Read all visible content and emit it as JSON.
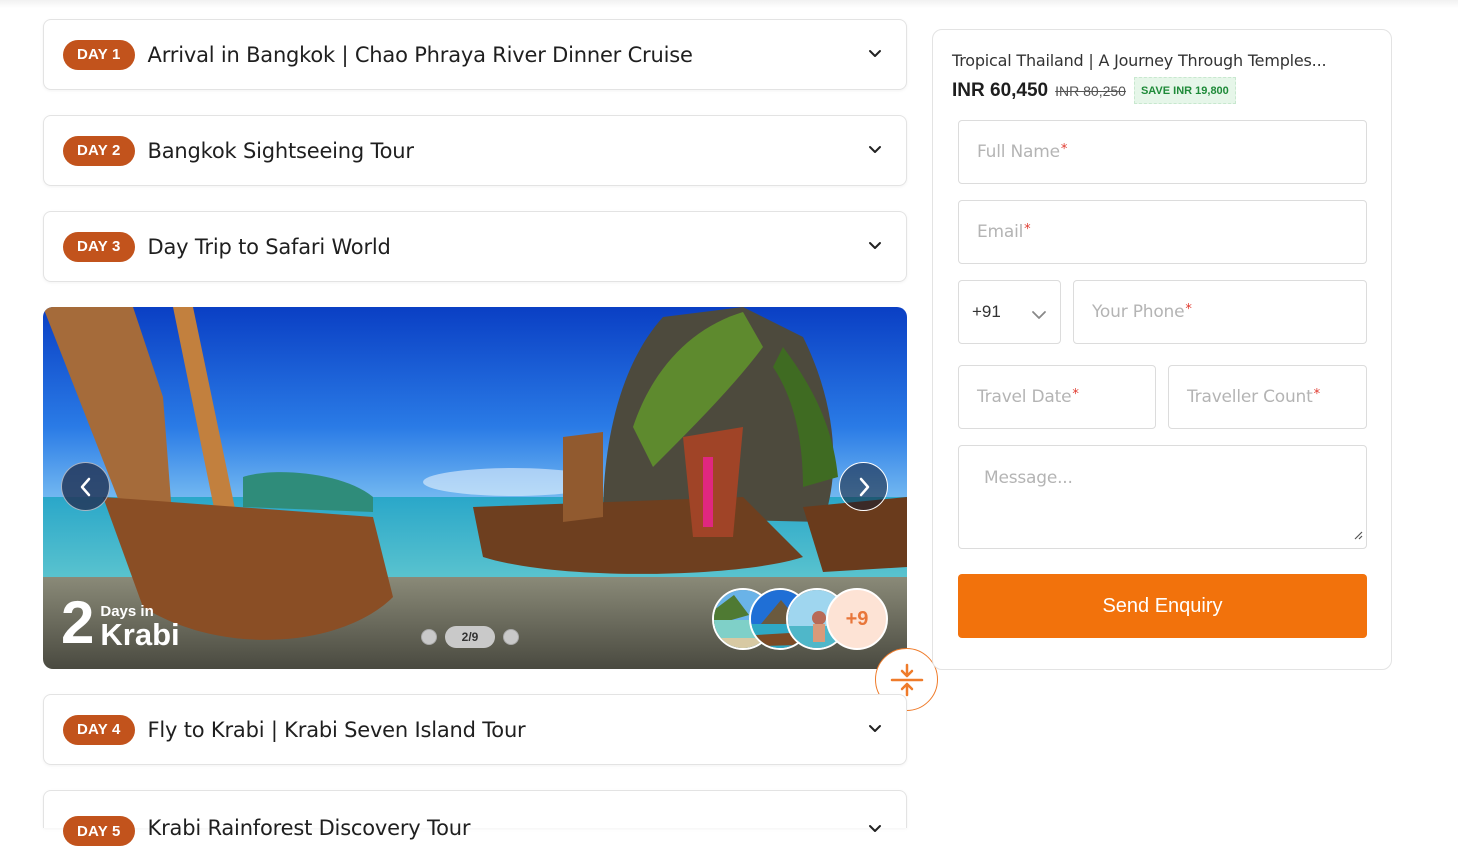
{
  "itinerary": {
    "days": [
      {
        "badge": "DAY 1",
        "title": "Arrival in Bangkok | Chao Phraya River Dinner Cruise"
      },
      {
        "badge": "DAY 2",
        "title": "Bangkok Sightseeing Tour"
      },
      {
        "badge": "DAY 3",
        "title": "Day Trip to Safari World"
      },
      {
        "badge": "DAY 4",
        "title": "Fly to Krabi | Krabi Seven Island Tour"
      },
      {
        "badge": "DAY 5",
        "title": "Krabi Rainforest Discovery Tour"
      }
    ]
  },
  "gallery": {
    "days_number": "2",
    "days_label": "Days in",
    "place": "Krabi",
    "pager": "2/9",
    "more_count": "+9",
    "icons": {
      "prev": "chevron-left-icon",
      "next": "chevron-right-icon",
      "collapse": "collapse-vertical-icon"
    }
  },
  "enquiry": {
    "package_title": "Tropical Thailand | A Journey Through Temples...",
    "price": "INR 60,450",
    "old_price": "INR 80,250",
    "save": "SAVE INR 19,800",
    "full_name": "Full Name",
    "email": "Email",
    "country_code": "+91",
    "phone": "Your Phone",
    "travel_date": "Travel Date",
    "traveller_count": "Traveller Count",
    "message": "Message...",
    "required_mark": "*",
    "submit": "Send Enquiry"
  },
  "colors": {
    "badge": "#c2531c",
    "accent": "#f2720c",
    "save_text": "#1f8a39",
    "required": "#e03a2f"
  }
}
